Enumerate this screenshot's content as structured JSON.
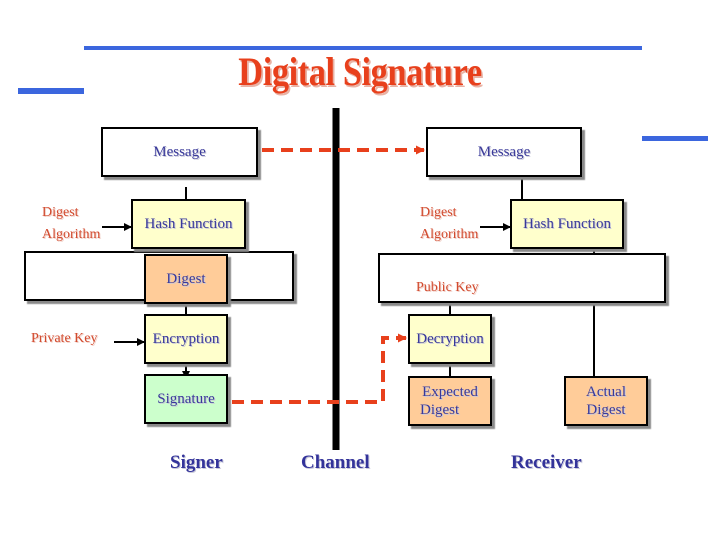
{
  "title": "Digital Signature",
  "colors": {
    "title": "#e8401c",
    "accent_bar": "#3b66de",
    "box_text": "#3a3a9a",
    "side_label": "#d24a2e",
    "dashed_flow": "#e8401c",
    "hash_fill": "#ffffcc",
    "digest_fill": "#ffcc99",
    "signature_fill": "#ccffcc"
  },
  "signer": {
    "role_label": "Signer",
    "message": "Message",
    "hash_function": "Hash Function",
    "digest_algorithm_line1": "Digest",
    "digest_algorithm_line2": "Algorithm",
    "digest": "Digest",
    "private_key": "Private Key",
    "encryption": "Encryption",
    "signature": "Signature"
  },
  "channel": {
    "role_label": "Channel"
  },
  "receiver": {
    "role_label": "Receiver",
    "message": "Message",
    "hash_function": "Hash Function",
    "digest_algorithm_line1": "Digest",
    "digest_algorithm_line2": "Algorithm",
    "public_key": "Public Key",
    "decryption": "Decryption",
    "expected_digest_line1": "Expected",
    "expected_digest_line2": "Digest",
    "actual_digest_line1": "Actual",
    "actual_digest_line2": "Digest"
  }
}
